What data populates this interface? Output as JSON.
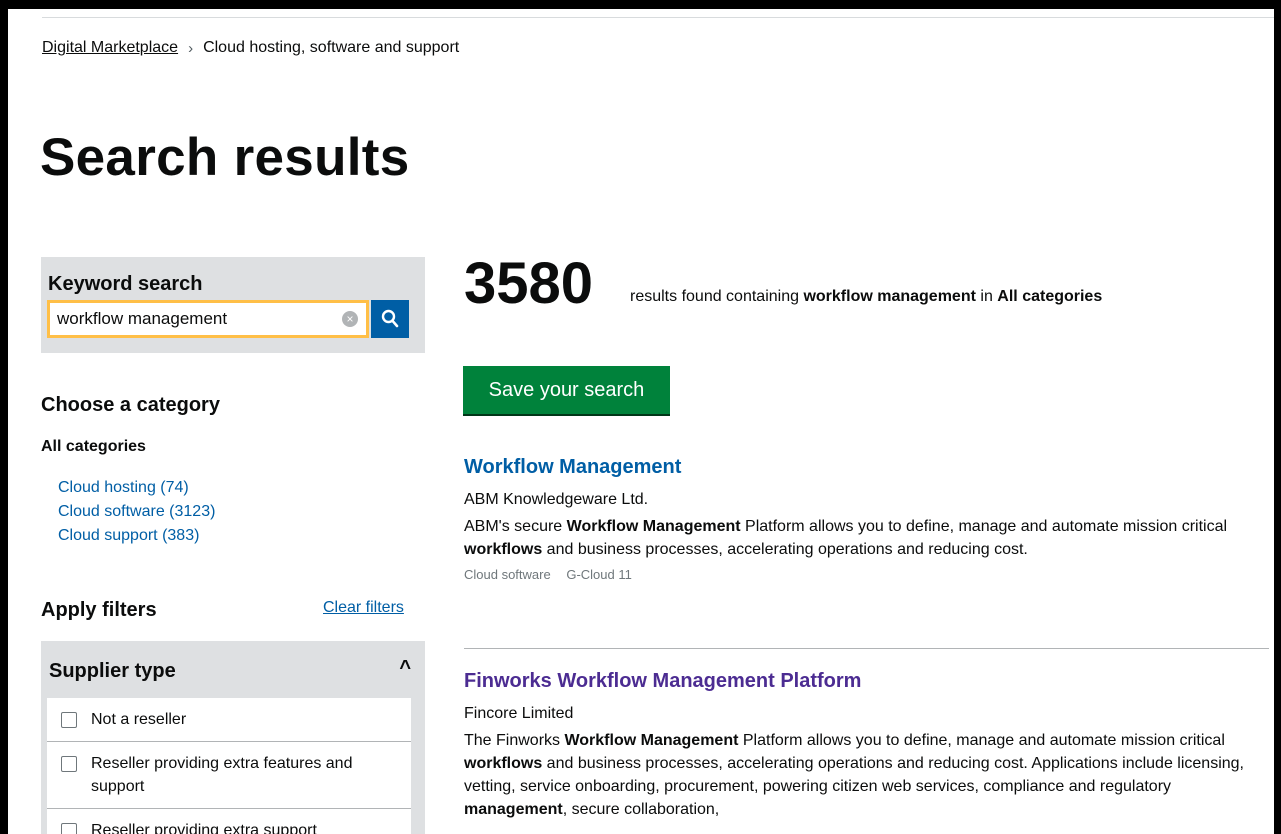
{
  "breadcrumb": {
    "home": "Digital Marketplace",
    "separator": "›",
    "current": "Cloud hosting, software and support"
  },
  "page_title": "Search results",
  "keyword_search": {
    "label": "Keyword search",
    "value": "workflow management",
    "clear_glyph": "×"
  },
  "categories": {
    "heading": "Choose a category",
    "all_label": "All categories",
    "items": [
      {
        "label": "Cloud hosting (74)"
      },
      {
        "label": "Cloud software (3123)"
      },
      {
        "label": "Cloud support (383)"
      }
    ]
  },
  "filters": {
    "heading": "Apply filters",
    "clear_label": "Clear filters",
    "group_title": "Supplier type",
    "caret": "^",
    "options": [
      {
        "label": "Not a reseller"
      },
      {
        "label": "Reseller providing extra features and support"
      },
      {
        "label": "Reseller providing extra support"
      }
    ]
  },
  "results_summary": {
    "count": "3580",
    "text_prefix": "results found containing",
    "keyword": "workflow management",
    "text_mid": "in",
    "category": "All categories"
  },
  "save_search_label": "Save your search",
  "results": [
    {
      "title": "Workflow Management",
      "supplier": "ABM Knowledgeware Ltd.",
      "desc": [
        {
          "t": "ABM's secure ",
          "b": false
        },
        {
          "t": "Workflow Management",
          "b": true
        },
        {
          "t": " Platform allows you to define, manage and automate mission critical ",
          "b": false
        },
        {
          "t": "workflows",
          "b": true
        },
        {
          "t": " and business processes, accelerating operations and reducing cost.",
          "b": false
        }
      ],
      "meta": [
        "Cloud software",
        "G-Cloud 11"
      ]
    },
    {
      "title": "Finworks Workflow Management Platform",
      "supplier": "Fincore Limited",
      "desc": [
        {
          "t": "The Finworks ",
          "b": false
        },
        {
          "t": "Workflow Management",
          "b": true
        },
        {
          "t": " Platform allows you to define, manage and automate mission critical ",
          "b": false
        },
        {
          "t": "workflows",
          "b": true
        },
        {
          "t": " and business processes, accelerating operations and reducing cost. Applications include licensing, vetting, service onboarding, procurement, powering citizen web services, compliance and regulatory ",
          "b": false
        },
        {
          "t": "management",
          "b": true
        },
        {
          "t": ", secure collaboration,",
          "b": false
        }
      ],
      "meta": []
    }
  ],
  "colors": {
    "link": "#005ea5",
    "visited": "#4c2c92",
    "save_button": "#00823b",
    "focus": "#ffbf47",
    "panel": "#dee0e2"
  }
}
